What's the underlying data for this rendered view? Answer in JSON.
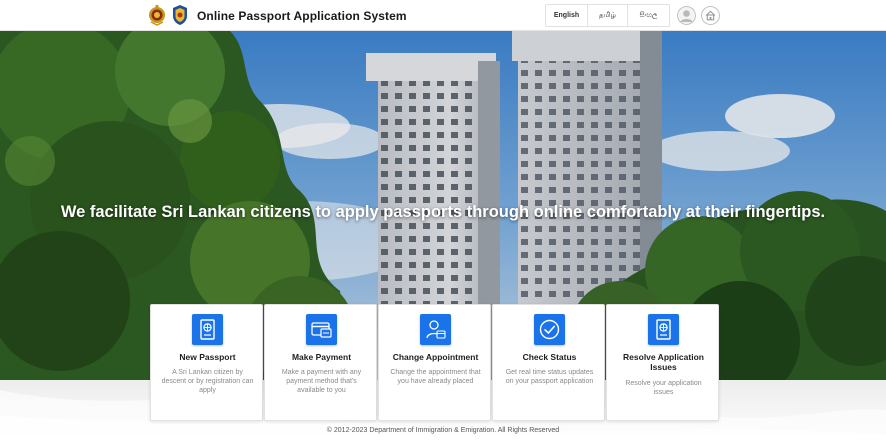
{
  "header": {
    "app_title": "Online Passport Application System",
    "languages": [
      "English",
      "தமிழ்",
      "සිංහල"
    ],
    "selected_language": "English",
    "icons": [
      "sri-lanka-emblem",
      "immigration-emblem",
      "profile-icon",
      "home-icon"
    ]
  },
  "hero": {
    "tagline": "We facilitate Sri Lankan citizens to apply passports through online comfortably at their fingertips."
  },
  "services": [
    {
      "icon": "passport-icon",
      "title": "New Passport",
      "description": "A Sri Lankan citizen by descent or by registration can apply"
    },
    {
      "icon": "payment-card-icon",
      "title": "Make Payment",
      "description": "Make a payment with any payment method that's available to you"
    },
    {
      "icon": "appointment-user-icon",
      "title": "Change Appointment",
      "description": "Change the appointment that you have already placed"
    },
    {
      "icon": "check-circle-icon",
      "title": "Check Status",
      "description": "Get real time status updates on your passport application"
    },
    {
      "icon": "passport-icon",
      "title": "Resolve Application Issues",
      "description": "Resolve your application issues"
    }
  ],
  "footer": {
    "copyright": "© 2012-2023 Department of Immigration & Emigration. All Rights Reserved"
  },
  "colors": {
    "accent": "#1a73e8",
    "header_bg": "#ffffff",
    "sky": "#4a8fd6",
    "foliage": "#2f5f23"
  }
}
